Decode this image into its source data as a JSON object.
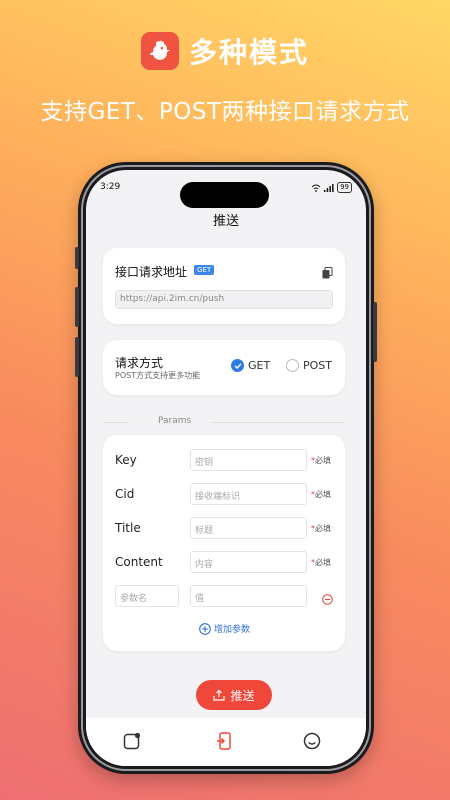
{
  "banner": {
    "title": "多种模式",
    "subtitle": "支持GET、POST两种接口请求方式"
  },
  "status_bar": {
    "time": "3:29",
    "battery": "99"
  },
  "nav": {
    "title": "推送"
  },
  "url_card": {
    "label": "接口请求地址",
    "badge": "GET",
    "url_value": "https://api.2im.cn/push"
  },
  "method_card": {
    "title": "请求方式",
    "subtitle": "POST方式支持更多功能",
    "options": [
      "GET",
      "POST"
    ],
    "selected": "GET"
  },
  "params": {
    "section_label": "Params",
    "rows": [
      {
        "key": "Key",
        "placeholder": "密钥",
        "required": "必填"
      },
      {
        "key": "Cid",
        "placeholder": "接收端标识",
        "required": "必填"
      },
      {
        "key": "Title",
        "placeholder": "标题",
        "required": "必填"
      },
      {
        "key": "Content",
        "placeholder": "内容",
        "required": "必填"
      }
    ],
    "custom_row": {
      "key_placeholder": "参数名",
      "value_placeholder": "值"
    },
    "add_label": "增加参数"
  },
  "push_button": {
    "label": "推送"
  },
  "colors": {
    "accent_red": "#f0473b",
    "accent_blue": "#2f7be6"
  },
  "tabbar": {
    "icons": [
      "note-icon",
      "send-phone-icon",
      "smile-icon"
    ],
    "active_index": 1
  }
}
